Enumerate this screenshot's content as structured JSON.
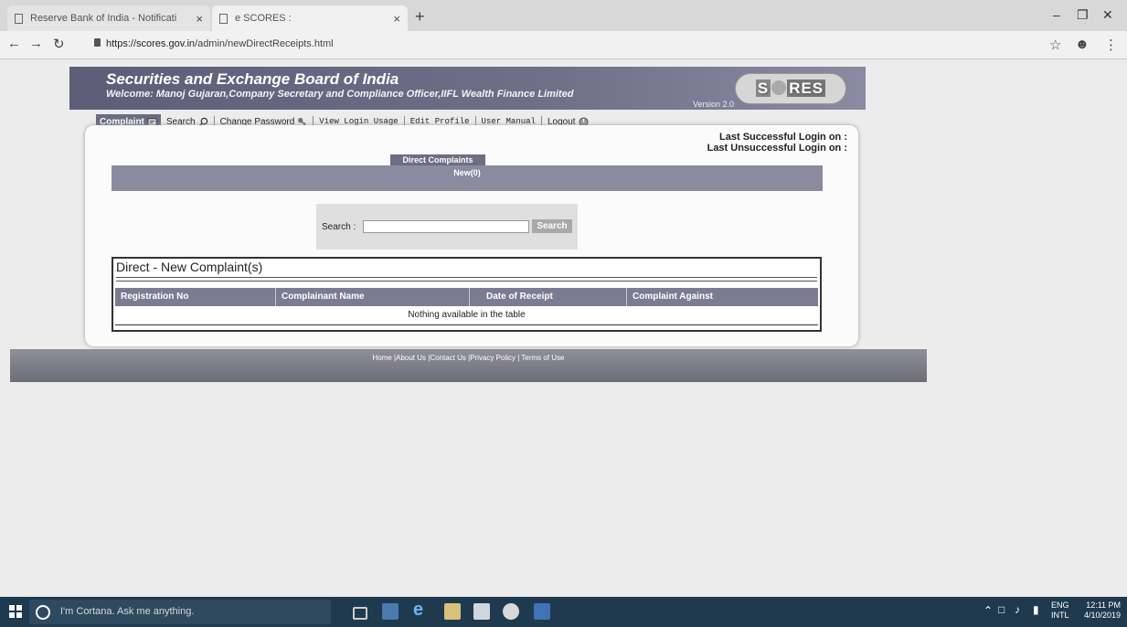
{
  "browser": {
    "tabs": [
      {
        "label": "Reserve Bank of India - Notificati",
        "close": "×"
      },
      {
        "label": "e SCORES :",
        "close": "×"
      }
    ],
    "new_tab": "+",
    "url_host": "https://scores.gov.in",
    "url_path": "/admin/newDirectReceipts.html"
  },
  "banner": {
    "title": "Securities and Exchange Board of India",
    "welcome": "Welcome: Manoj Gujaran,Company Secretary and Compliance Officer,IIFL Wealth Finance Limited",
    "version": "Version 2.0",
    "logo_a": "S",
    "logo_b": "RES"
  },
  "menu": {
    "complaint": "Complaint",
    "search": "Search",
    "change_password": "Change Password",
    "view_login_usage": "View Login Usage",
    "edit_profile": "Edit Profile",
    "user_manual": "User Manual",
    "logout": "Logout"
  },
  "login_info": {
    "last_success": "Last Successful Login on :",
    "last_unsuccess": "Last Unsuccessful Login on :"
  },
  "direct": {
    "tab_label": "Direct Complaints",
    "new_label": "New",
    "new_count": "(0)"
  },
  "search": {
    "label": "Search :",
    "value": "",
    "button": "Search"
  },
  "complaints_table": {
    "title": "Direct - New Complaint(s)",
    "columns": [
      "Registration No",
      "Complainant Name",
      "Date of Receipt",
      "Complaint Against"
    ],
    "empty_message": "Nothing available in the table"
  },
  "footer": {
    "links": "Home |About Us |Contact Us |Privacy Policy | Terms of Use"
  },
  "taskbar": {
    "cortana_placeholder": "I'm Cortana. Ask me anything.",
    "lang_top": "ENG",
    "lang_bottom": "INTL",
    "time": "12:11 PM",
    "date": "4/10/2019"
  }
}
